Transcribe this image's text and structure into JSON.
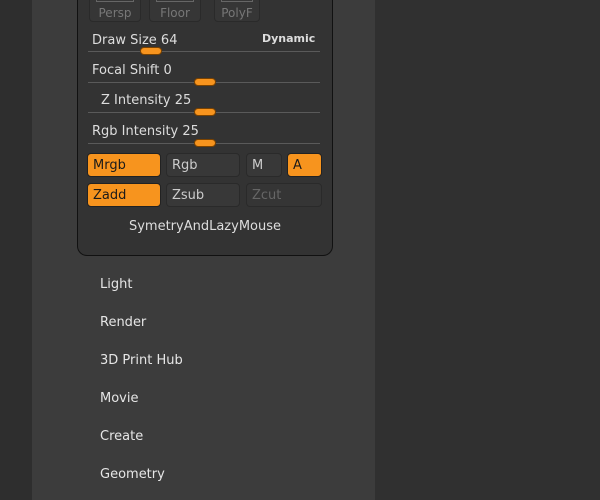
{
  "top_buttons": [
    {
      "label": "Persp"
    },
    {
      "label": "Floor"
    },
    {
      "label": "PolyF"
    }
  ],
  "dynamic_label": "Dynamic",
  "sliders": [
    {
      "label": "Draw Size",
      "value": "64",
      "fraction": 0.25
    },
    {
      "label": "Focal Shift",
      "value": "0",
      "fraction": 0.5
    },
    {
      "label": "Z Intensity",
      "value": "25",
      "fraction": 0.5
    },
    {
      "label": "Rgb Intensity",
      "value": "25",
      "fraction": 0.5
    }
  ],
  "modes": {
    "mrgb": "Mrgb",
    "rgb": "Rgb",
    "m": "M",
    "a": "A",
    "zadd": "Zadd",
    "zsub": "Zsub",
    "zcut": "Zcut"
  },
  "sub_palette": "SymetryAndLazyMouse",
  "menu": [
    "Light",
    "Render",
    "3D Print Hub",
    "Movie",
    "Create",
    "Geometry"
  ],
  "colors": {
    "accent": "#f7941e"
  }
}
